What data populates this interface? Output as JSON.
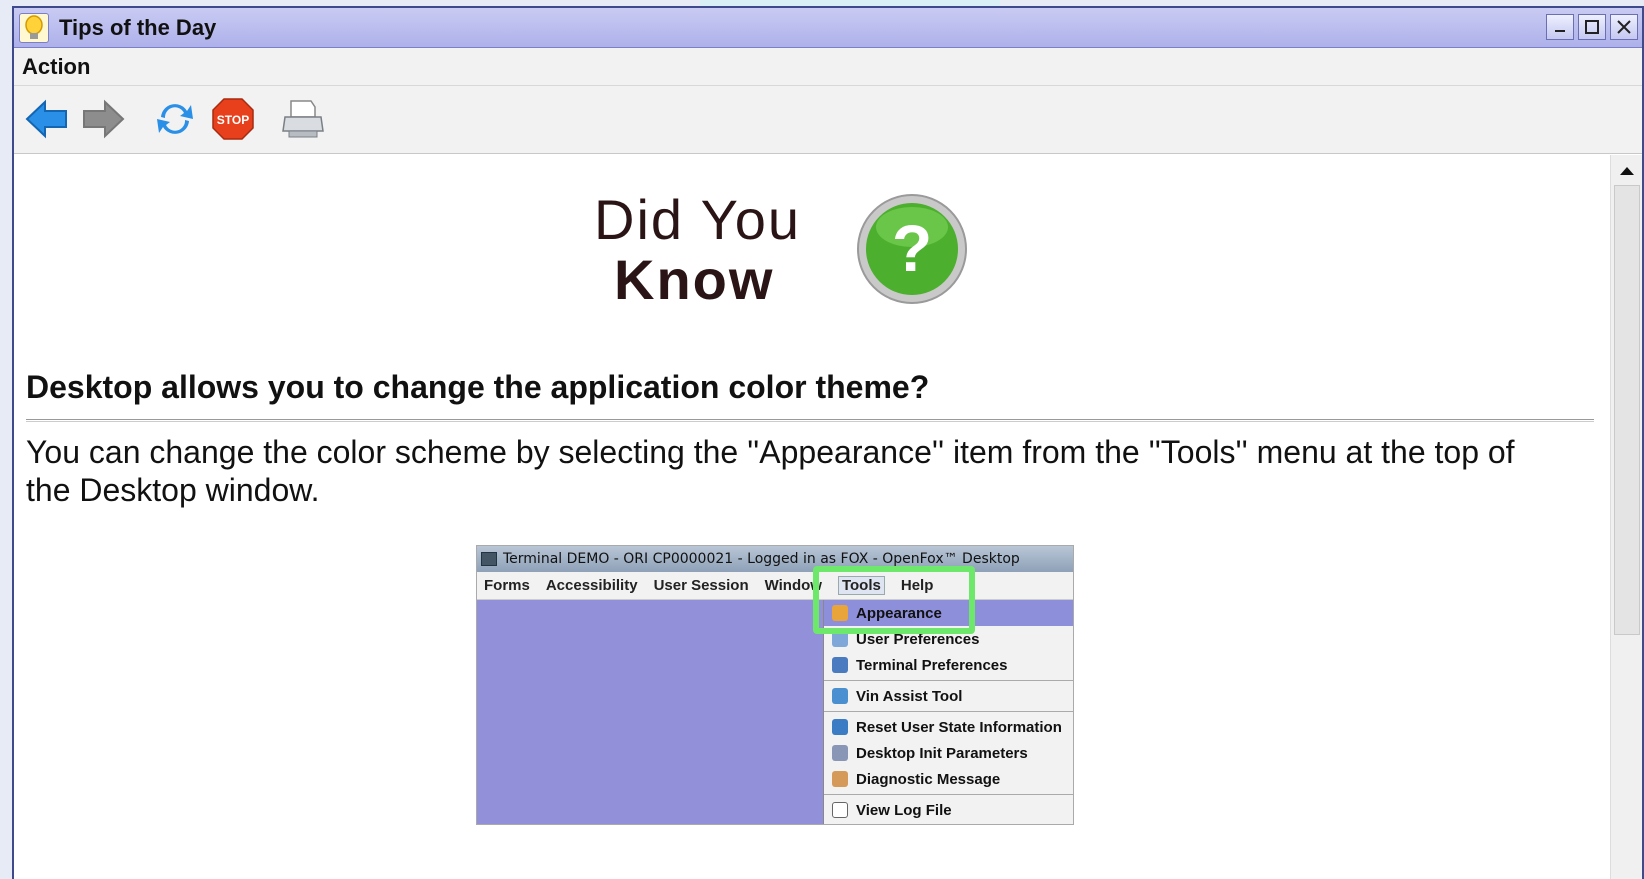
{
  "window": {
    "title": "Tips of the Day",
    "icon": "lightbulb-icon",
    "controls": [
      "minimize-icon",
      "maximize-icon",
      "close-icon"
    ]
  },
  "menubar": {
    "action": "Action"
  },
  "toolbar": {
    "buttons": [
      {
        "name": "back",
        "icon": "back-arrow-icon"
      },
      {
        "name": "forward",
        "icon": "forward-arrow-icon"
      },
      {
        "name": "refresh",
        "icon": "refresh-icon"
      },
      {
        "name": "stop",
        "icon": "stop-icon",
        "label": "STOP"
      },
      {
        "name": "print",
        "icon": "printer-icon"
      }
    ]
  },
  "banner": {
    "line1": "Did You",
    "line2": "Know",
    "icon": "question-mark-icon"
  },
  "tip": {
    "title": "Desktop allows you to change the application color theme?",
    "body": " You can change the color scheme by selecting the ''Appearance'' item from the ''Tools'' menu at the top of the Desktop window."
  },
  "screenshot": {
    "title": "Terminal DEMO - ORI CP0000021 - Logged in as FOX - OpenFox™ Desktop",
    "menus": [
      "Forms",
      "Accessibility",
      "User Session",
      "Window",
      "Tools",
      "Help"
    ],
    "tools_menu": [
      {
        "label": "Appearance",
        "selected": true
      },
      {
        "label": "User Preferences"
      },
      {
        "label": "Terminal Preferences"
      },
      {
        "label": "Vin Assist Tool"
      },
      {
        "label": "Reset User State Information"
      },
      {
        "label": "Desktop Init Parameters"
      },
      {
        "label": "Diagnostic Message"
      },
      {
        "label": "View Log File"
      }
    ]
  },
  "colors": {
    "titlebar": "#aeb1ea",
    "highlight_box": "#6ee86b",
    "desktop_area": "#9290d9"
  }
}
